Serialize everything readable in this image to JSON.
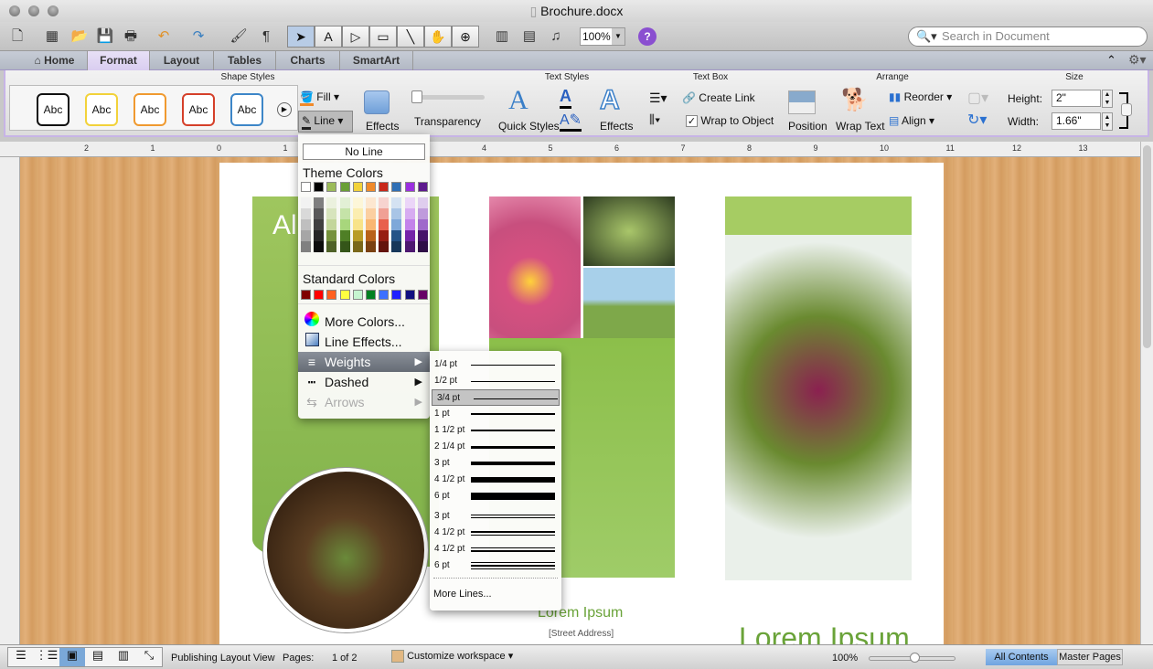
{
  "window": {
    "title": "Brochure.docx"
  },
  "toolbar": {
    "zoom": "100%",
    "search_placeholder": "Search in Document"
  },
  "tabs": [
    {
      "label": "Home"
    },
    {
      "label": "Format"
    },
    {
      "label": "Layout"
    },
    {
      "label": "Tables"
    },
    {
      "label": "Charts"
    },
    {
      "label": "SmartArt"
    }
  ],
  "active_tab": "Format",
  "ribbon": {
    "groups": {
      "shape_styles": "Shape Styles",
      "text_styles": "Text Styles",
      "text_box": "Text Box",
      "arrange": "Arrange",
      "size": "Size"
    },
    "style_samples": [
      {
        "label": "Abc",
        "color": "#111111"
      },
      {
        "label": "Abc",
        "color": "#f2d23a"
      },
      {
        "label": "Abc",
        "color": "#f09a30"
      },
      {
        "label": "Abc",
        "color": "#d5402a"
      },
      {
        "label": "Abc",
        "color": "#3d86c8"
      }
    ],
    "fill": "Fill",
    "line": "Line",
    "effects": "Effects",
    "transparency": "Transparency",
    "quick_styles": "Quick Styles",
    "text_effects": "Effects",
    "create_link": "Create Link",
    "wrap_to_object": "Wrap to Object",
    "wrap_to_object_checked": true,
    "position": "Position",
    "wrap_text": "Wrap Text",
    "reorder": "Reorder",
    "align": "Align",
    "height_label": "Height:",
    "height_value": "2\"",
    "width_label": "Width:",
    "width_value": "1.66\""
  },
  "ruler": {
    "labels": [
      "2",
      "1",
      "0",
      "1",
      "2",
      "3",
      "4",
      "5",
      "6",
      "7",
      "8",
      "9",
      "10",
      "11",
      "12",
      "13"
    ]
  },
  "line_menu": {
    "no_line": "No Line",
    "theme_colors": "Theme Colors",
    "theme_top": [
      "#ffffff",
      "#000000",
      "#9bbb59",
      "#6a9f36",
      "#f2d23a",
      "#f08a2a",
      "#c8281a",
      "#2f6fb5",
      "#9b30e0",
      "#5e1a8e"
    ],
    "theme_shades": [
      [
        "#f2f2f2",
        "#d9d9d9",
        "#bfbfbf",
        "#a6a6a6",
        "#808080"
      ],
      [
        "#7f7f7f",
        "#595959",
        "#404040",
        "#262626",
        "#0d0d0d"
      ],
      [
        "#ebf1de",
        "#d7e4bd",
        "#c3d69b",
        "#76923c",
        "#4f6228"
      ],
      [
        "#e2f0d5",
        "#c5e3a8",
        "#a8d67c",
        "#4f7f26",
        "#345519"
      ],
      [
        "#fdf6d8",
        "#fbedb0",
        "#f8e389",
        "#b89c26",
        "#7a681a"
      ],
      [
        "#fde7d0",
        "#fbcfa1",
        "#f9b772",
        "#b8621a",
        "#7a4111"
      ],
      [
        "#f7d3cf",
        "#f0a095",
        "#e8604d",
        "#961e13",
        "#64140c"
      ],
      [
        "#d4e2f2",
        "#a9c5e6",
        "#7ea8d9",
        "#235387",
        "#17375a"
      ],
      [
        "#ebd5f8",
        "#d7acf1",
        "#c382ea",
        "#7422a8",
        "#4d1770"
      ],
      [
        "#dfcdee",
        "#bf9bdc",
        "#9f69cb",
        "#46136a",
        "#2f0d47"
      ]
    ],
    "standard_colors_label": "Standard Colors",
    "standard_colors": [
      "#7f0000",
      "#ff0000",
      "#ff6020",
      "#ffff40",
      "#c6f5d0",
      "#008020",
      "#3d70ff",
      "#2020ff",
      "#101080",
      "#660066"
    ],
    "items": [
      {
        "label": "More Colors...",
        "icon": "color-wheel-icon"
      },
      {
        "label": "Line Effects...",
        "icon": "line-effects-icon"
      },
      {
        "label": "Weights",
        "icon": "weights-icon",
        "highlighted": true
      },
      {
        "label": "Dashed",
        "icon": "dashed-icon"
      },
      {
        "label": "Arrows",
        "icon": "arrows-icon",
        "disabled": true
      }
    ]
  },
  "weights_menu": {
    "items": [
      {
        "label": "1/4 pt",
        "lines": [
          1
        ]
      },
      {
        "label": "1/2 pt",
        "lines": [
          1
        ]
      },
      {
        "label": "3/4 pt",
        "lines": [
          1
        ],
        "selected": true
      },
      {
        "label": "1 pt",
        "lines": [
          2
        ]
      },
      {
        "label": "1 1/2 pt",
        "lines": [
          2
        ]
      },
      {
        "label": "2 1/4 pt",
        "lines": [
          3
        ]
      },
      {
        "label": "3 pt",
        "lines": [
          4
        ]
      },
      {
        "label": "4 1/2 pt",
        "lines": [
          6
        ]
      },
      {
        "label": "6 pt",
        "lines": [
          8
        ]
      },
      {
        "label": "3 pt",
        "lines": [
          1,
          1
        ]
      },
      {
        "label": "4 1/2 pt",
        "lines": [
          2,
          1
        ]
      },
      {
        "label": "4 1/2 pt",
        "lines": [
          1,
          2
        ]
      },
      {
        "label": "6 pt",
        "lines": [
          1,
          2,
          1
        ]
      }
    ],
    "more_lines": "More Lines..."
  },
  "document": {
    "heading_partial": "Al",
    "lorem_small": "Lorem Ipsum",
    "street": "[Street Address]",
    "lorem_large": "Lorem Ipsum",
    "accent": "#8cbf4a"
  },
  "status": {
    "view": "Publishing Layout View",
    "pages_label": "Pages:",
    "pages_value": "1 of 2",
    "workspace": "Customize workspace",
    "zoom": "100%",
    "all_contents": "All Contents",
    "master_pages": "Master Pages"
  }
}
